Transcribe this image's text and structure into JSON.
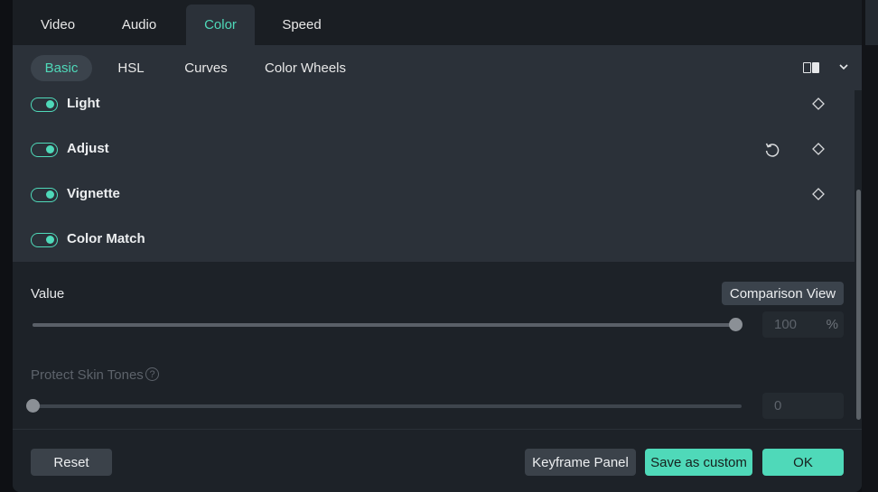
{
  "tabs": [
    {
      "label": "Video",
      "active": false
    },
    {
      "label": "Audio",
      "active": false
    },
    {
      "label": "Color",
      "active": true
    },
    {
      "label": "Speed",
      "active": false
    }
  ],
  "subtabs": [
    {
      "label": "Basic",
      "active": true
    },
    {
      "label": "HSL",
      "active": false
    },
    {
      "label": "Curves",
      "active": false
    },
    {
      "label": "Color Wheels",
      "active": false
    }
  ],
  "toolbar_icons": [
    "compare-view-icon",
    "chevron-down-icon"
  ],
  "sections": [
    {
      "label": "Light",
      "enabled": true,
      "icons": [
        "keyframe-diamond-icon"
      ]
    },
    {
      "label": "Adjust",
      "enabled": true,
      "icons": [
        "reset-icon",
        "keyframe-diamond-icon"
      ]
    },
    {
      "label": "Vignette",
      "enabled": true,
      "icons": [
        "keyframe-diamond-icon"
      ]
    },
    {
      "label": "Color Match",
      "enabled": true,
      "icons": []
    }
  ],
  "color_match": {
    "value_label": "Value",
    "comparison_button": "Comparison View",
    "value": "100",
    "value_unit": "%",
    "value_fraction": 1.0,
    "protect_label": "Protect Skin Tones",
    "protect_value": "0",
    "protect_fraction": 0.0
  },
  "footer": {
    "reset": "Reset",
    "keyframe_panel": "Keyframe Panel",
    "save_custom": "Save as custom",
    "ok": "OK"
  },
  "colors": {
    "accent": "#4fd9b9",
    "panel": "#1d2228",
    "section_bg": "#2b3139",
    "button_gray": "#3b424a"
  }
}
